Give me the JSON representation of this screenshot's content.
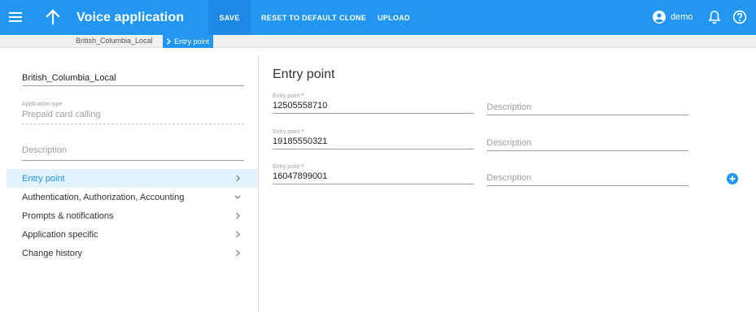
{
  "appbar": {
    "title": "Voice application",
    "save_label": "SAVE",
    "reset_label": "RESET TO DEFAULT",
    "clone_label": "CLONE",
    "upload_label": "UPLOAD",
    "user_name": "demo"
  },
  "breadcrumb": {
    "parent": "British_Columbia_Local",
    "current": "Entry point"
  },
  "left_panel": {
    "name_value": "British_Columbia_Local",
    "app_type_label": "Application type",
    "app_type_value": "Prepaid card calling",
    "description_placeholder": "Description",
    "nav_items": [
      {
        "label": "Entry point",
        "active": true,
        "chevron": "chevron-right-icon"
      },
      {
        "label": "Authentication, Authorization, Accounting",
        "active": false,
        "chevron": "chevron-down-icon"
      },
      {
        "label": "Prompts & notifications",
        "active": false,
        "chevron": "chevron-right-icon"
      },
      {
        "label": "Application specific",
        "active": false,
        "chevron": "chevron-right-icon"
      },
      {
        "label": "Change history",
        "active": false,
        "chevron": "chevron-right-icon"
      }
    ]
  },
  "main": {
    "title": "Entry point",
    "entry_points": [
      {
        "label": "Entry point",
        "required_mark": "*",
        "value": "12505558710",
        "description_placeholder": "Description"
      },
      {
        "label": "Entry point",
        "required_mark": "*",
        "value": "19185550321",
        "description_placeholder": "Description"
      },
      {
        "label": "Entry point",
        "required_mark": "*",
        "value": "16047899001",
        "description_placeholder": "Description"
      }
    ]
  },
  "colors": {
    "primary": "#2196f3",
    "active_nav_bg": "#e3f2fd",
    "required": "#e53935"
  },
  "icons": [
    "menu-icon",
    "arrow-up-icon",
    "account-circle-icon",
    "bell-icon",
    "help-icon",
    "chevron-right-icon",
    "chevron-down-icon",
    "add-circle-icon"
  ]
}
